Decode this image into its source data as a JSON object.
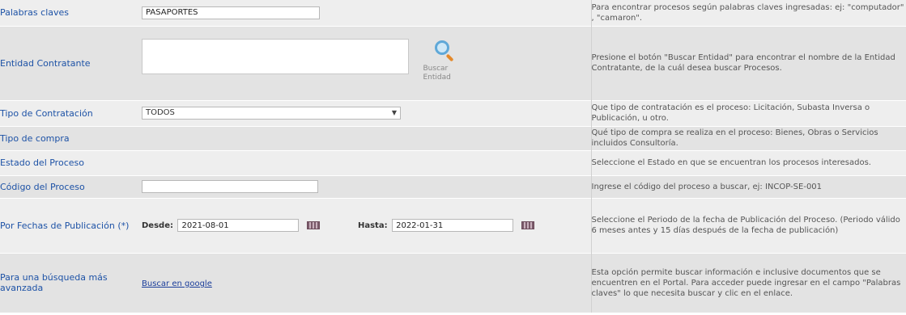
{
  "rows": {
    "keywords": {
      "label": "Palabras claves",
      "value": "PASAPORTES",
      "help": "Para encontrar procesos según palabras claves ingresadas: ej: \"computador\" , \"camaron\"."
    },
    "entity": {
      "label": "Entidad Contratante",
      "button_label": "Buscar Entidad",
      "help": "Presione el botón \"Buscar Entidad\" para encontrar el nombre de la Entidad Contratante, de la cuál desea buscar Procesos."
    },
    "contract_type": {
      "label": "Tipo de Contratación",
      "selected": "TODOS",
      "help": "Que tipo de contratación es el proceso: Licitación, Subasta Inversa o Publicación, u otro."
    },
    "purchase_type": {
      "label": "Tipo de compra",
      "help": "Qué tipo de compra se realiza en el proceso: Bienes, Obras o Servicios incluidos Consultoría."
    },
    "process_state": {
      "label": "Estado del Proceso",
      "help": "Seleccione el Estado en que se encuentran los procesos interesados."
    },
    "process_code": {
      "label": "Código del Proceso",
      "value": "",
      "help": "Ingrese el código del proceso a buscar, ej: INCOP-SE-001"
    },
    "dates": {
      "label": "Por Fechas de Publicación (*)",
      "from_label": "Desde:",
      "from_value": "2021-08-01",
      "to_label": "Hasta:",
      "to_value": "2022-01-31",
      "help": "Seleccione el Periodo de la fecha de Publicación del Proceso. (Periodo válido 6 meses antes y 15 días después de la fecha de publicación)"
    },
    "advanced": {
      "label": "Para una búsqueda más avanzada",
      "link": "Buscar en google",
      "help": "Esta opción permite buscar información e inclusive documentos que se encuentren en el Portal. Para acceder puede ingresar en el campo \"Palabras claves\" lo que necesita buscar y clic en el enlace."
    }
  },
  "icons": {
    "search_entity": "magnifier-icon",
    "calendar": "calendar-icon",
    "dropdown": "chevron-down-icon"
  },
  "colors": {
    "label_blue": "#1d52a6",
    "row_light": "#eeeeee",
    "row_dark": "#e3e3e3",
    "link": "#1a3d9a"
  }
}
